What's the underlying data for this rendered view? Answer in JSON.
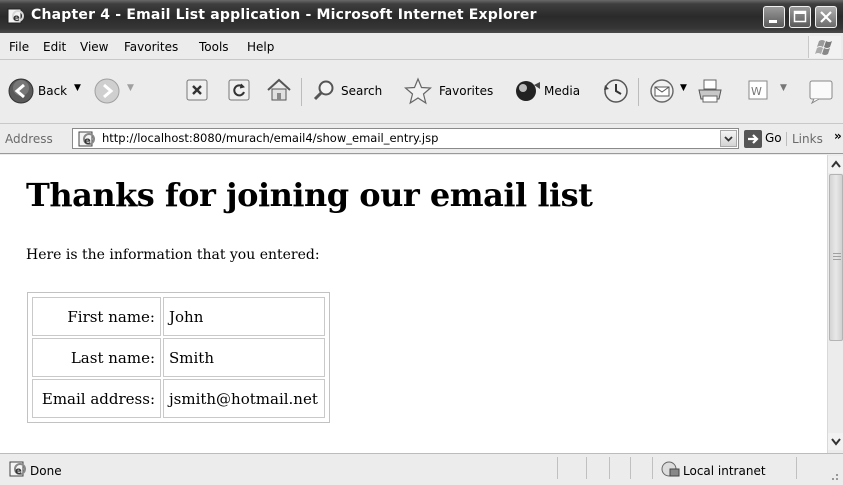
{
  "window": {
    "title": "Chapter 4 - Email List application - Microsoft Internet Explorer"
  },
  "menu": [
    "File",
    "Edit",
    "View",
    "Favorites",
    "Tools",
    "Help"
  ],
  "toolbar": {
    "back_label": "Back",
    "search_label": "Search",
    "favorites_label": "Favorites",
    "media_label": "Media"
  },
  "address": {
    "label": "Address",
    "url": "http://localhost:8080/murach/email4/show_email_entry.jsp",
    "go_label": "Go",
    "links_label": "Links"
  },
  "page": {
    "heading": "Thanks for joining our email list",
    "intro": "Here is the information that you entered:",
    "rows": [
      {
        "label": "First name:",
        "value": "John"
      },
      {
        "label": "Last name:",
        "value": "Smith"
      },
      {
        "label": "Email address:",
        "value": "jsmith@hotmail.net"
      }
    ]
  },
  "status": {
    "text": "Done",
    "zone": "Local intranet"
  },
  "icons": {
    "title": "ie-page-icon",
    "back": "back-arrow-icon",
    "forward": "forward-arrow-icon",
    "stop": "stop-icon",
    "refresh": "refresh-icon",
    "home": "home-icon",
    "search": "search-icon",
    "favorites": "star-icon",
    "media": "media-icon",
    "history": "history-icon",
    "mail": "mail-icon",
    "print": "print-icon",
    "edit": "word-edit-icon",
    "discuss": "discuss-icon"
  }
}
